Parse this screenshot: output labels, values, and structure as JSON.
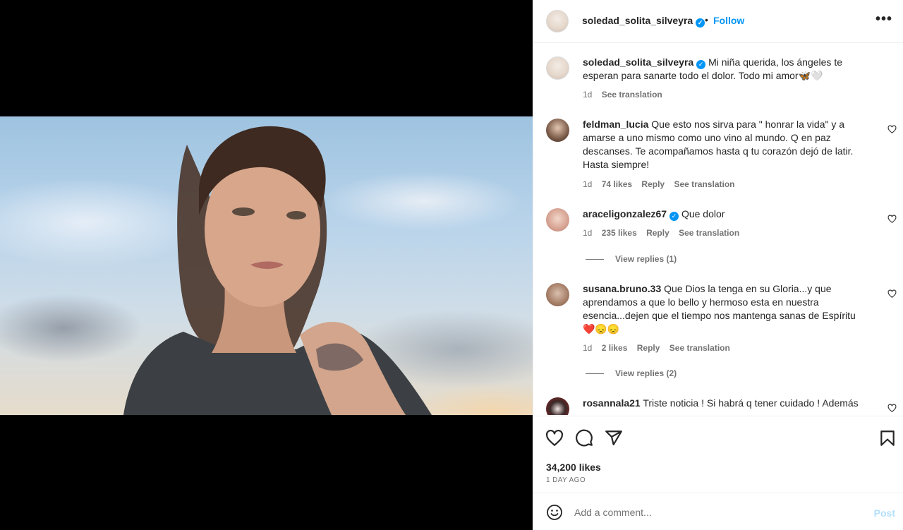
{
  "header": {
    "username": "soledad_solita_silveyra",
    "separator": "•",
    "follow_label": "Follow",
    "more_label": "•••"
  },
  "caption": {
    "username": "soledad_solita_silveyra",
    "text": "Mi niña querida, los ángeles te esperan para sanarte todo el dolor. Todo mi amor🦋🤍",
    "time": "1d",
    "see_translation": "See translation"
  },
  "comments": [
    {
      "username": "feldman_lucia",
      "text": "Que esto nos sirva para \" honrar la vida\" y a amarse a uno mismo como uno vino al mundo. Q en paz descanses. Te acompañamos hasta q tu corazón dejó de latir. Hasta siempre!",
      "time": "1d",
      "likes": "74 likes",
      "reply": "Reply",
      "see_translation": "See translation"
    },
    {
      "username": "araceligonzalez67",
      "text": "Que dolor",
      "time": "1d",
      "likes": "235 likes",
      "reply": "Reply",
      "see_translation": "See translation",
      "view_replies": "View replies (1)"
    },
    {
      "username": "susana.bruno.33",
      "text": "Que Dios la tenga en su Gloria...y que aprendamos a que lo bello y hermoso esta en nuestra esencia...dejen que el tiempo nos mantenga sanas de Espíritu",
      "emojis": "❤️😞😞",
      "time": "1d",
      "likes": "2 likes",
      "reply": "Reply",
      "see_translation": "See translation",
      "view_replies": "View replies (2)"
    },
    {
      "username": "rosannala21",
      "text": "Triste noticia ! Si habrá q tener cuidado ! Además"
    }
  ],
  "post": {
    "likes": "34,200 likes",
    "time_ago": "1 DAY AGO"
  },
  "add_comment": {
    "placeholder": "Add a comment...",
    "post_label": "Post"
  },
  "icons": {
    "like": "heart-icon",
    "comment": "comment-icon",
    "share": "share-icon",
    "save": "bookmark-icon",
    "emoji": "emoji-icon"
  },
  "colors": {
    "accent": "#0095f6",
    "muted": "#737373",
    "text": "#262626",
    "post_disabled": "#b2dffc"
  }
}
